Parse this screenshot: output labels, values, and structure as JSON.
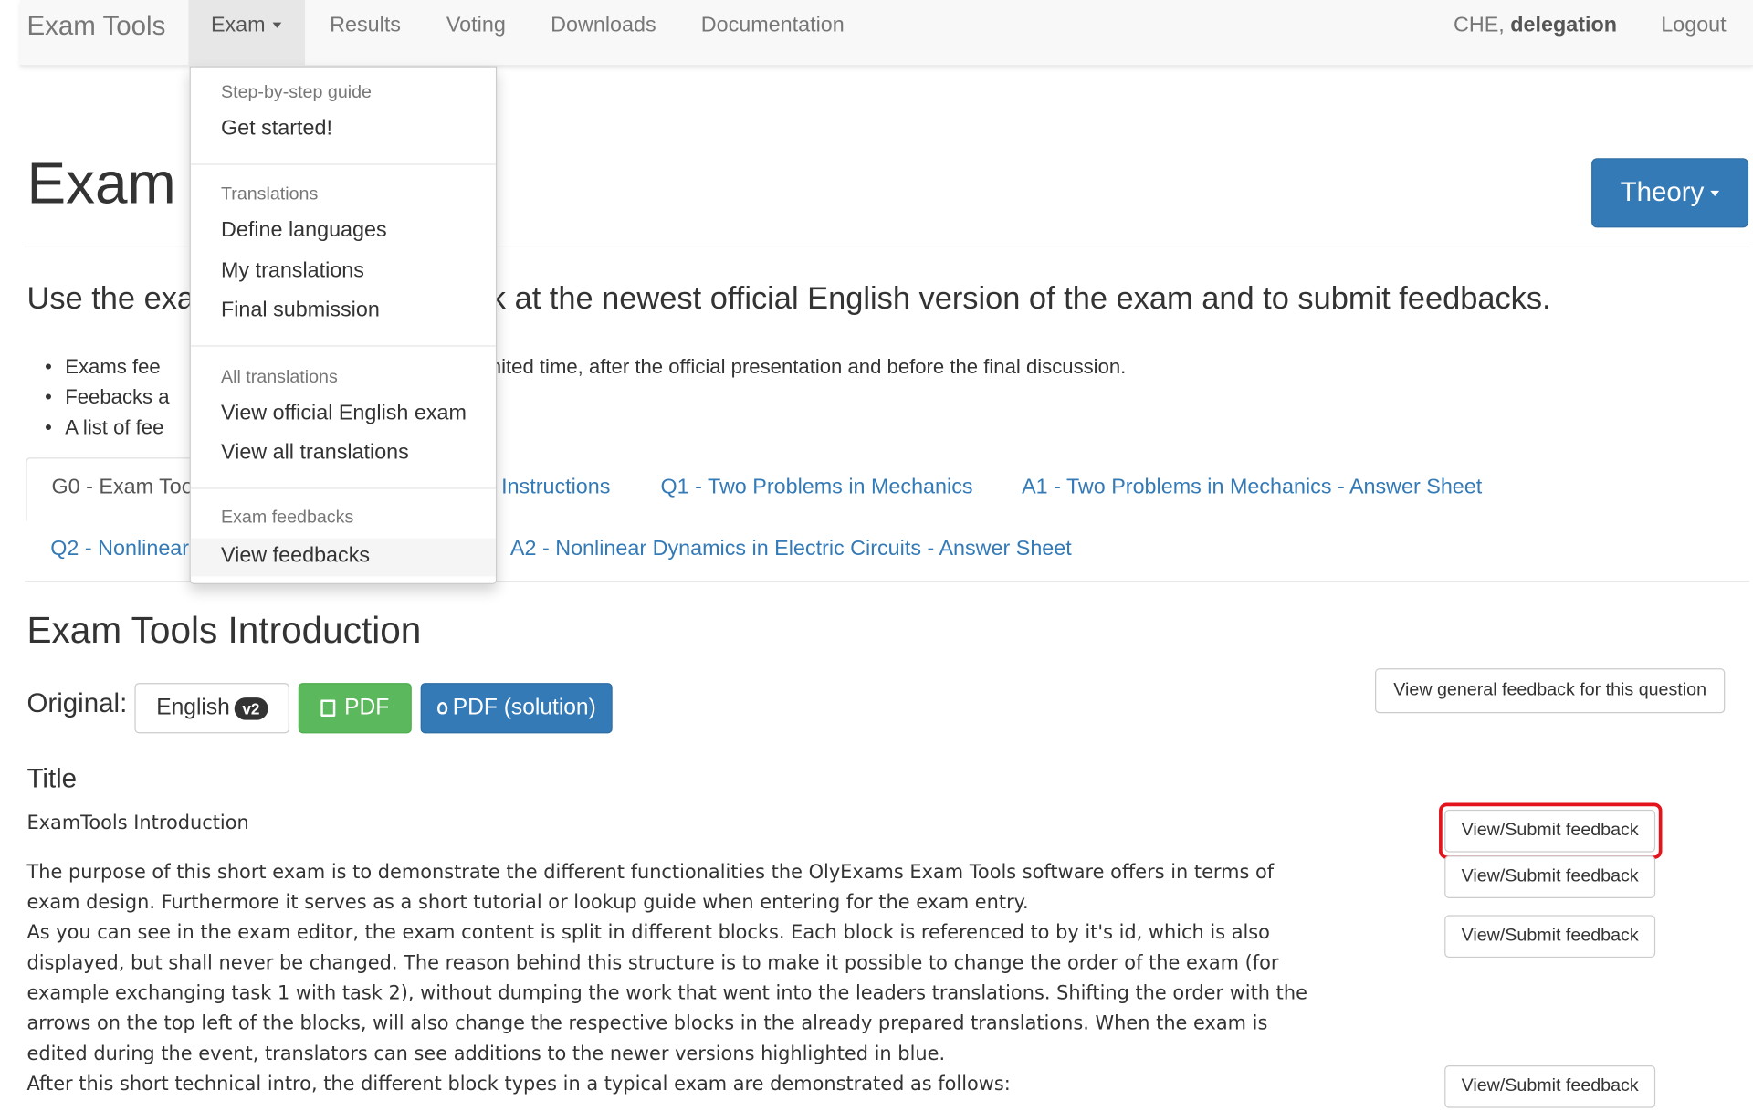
{
  "navbar": {
    "brand": "Exam Tools",
    "exam_menu": "Exam",
    "links": [
      "Results",
      "Voting",
      "Downloads",
      "Documentation"
    ],
    "user_country": "CHE,",
    "user_name": "delegation",
    "logout": "Logout"
  },
  "page": {
    "heading_visible": "Exam v",
    "theory_button": "Theory",
    "lead_left": "Use the exa",
    "lead_right": "k at the newest official English version of the exam and to submit feedbacks.",
    "bullets": [
      {
        "left": "Exams fee",
        "right": "nited time, after the official presentation and before the final discussion."
      },
      {
        "left": "Feebacks a",
        "right": ""
      },
      {
        "left": "A list of fee",
        "right": ""
      }
    ]
  },
  "tabs": {
    "active": "G0 - Exam Too",
    "row1": [
      "Instructions",
      "Q1 - Two Problems in Mechanics",
      "A1 - Two Problems in Mechanics - Answer Sheet"
    ],
    "row2_left": "Q2 - Nonlinear",
    "row2": [
      "A2 - Nonlinear Dynamics in Electric Circuits - Answer Sheet"
    ]
  },
  "section": {
    "title": "Exam Tools Introduction",
    "original_label": "Original:",
    "language": "English",
    "version_badge": "v2",
    "pdf": "PDF",
    "pdf_solution": "PDF (solution)",
    "general_feedback": "View general feedback for this question",
    "subtitle": "Title",
    "intro_title": "ExamTools Introduction",
    "paragraphs": [
      "The purpose of this short exam is to demonstrate the different functionalities the OlyExams Exam Tools software offers in terms of exam design. Furthermore it serves as a short tutorial or lookup guide when entering for the exam entry.",
      "As you can see in the exam editor, the exam content is split in different blocks. Each block is referenced to by it's id, which is also displayed, but shall never be changed. The reason behind this structure is to make it possible to change the order of the exam (for example exchanging task 1 with task 2), without dumping the work that went into the leaders translations. Shifting the order with the arrows on the top left of the blocks, will also change the respective blocks in the already prepared translations. When the exam is edited during the event, translators can see additions to the newer versions highlighted in blue.",
      "After this short technical intro, the different block types in a typical exam are demonstrated as follows:"
    ],
    "feedback_buttons": [
      "View/Submit feedback",
      "View/Submit feedback",
      "View/Submit feedback",
      "View/Submit feedback"
    ]
  },
  "dropdown": {
    "groups": [
      {
        "header": "Step-by-step guide",
        "items": [
          "Get started!"
        ]
      },
      {
        "header": "Translations",
        "items": [
          "Define languages",
          "My translations",
          "Final submission"
        ]
      },
      {
        "header": "All translations",
        "items": [
          "View official English exam",
          "View all translations"
        ]
      },
      {
        "header": "Exam feedbacks",
        "items": [
          "View feedbacks"
        ]
      }
    ]
  },
  "colors": {
    "primary": "#337ab7",
    "success": "#5cb85c",
    "highlight": "#e3141b"
  }
}
